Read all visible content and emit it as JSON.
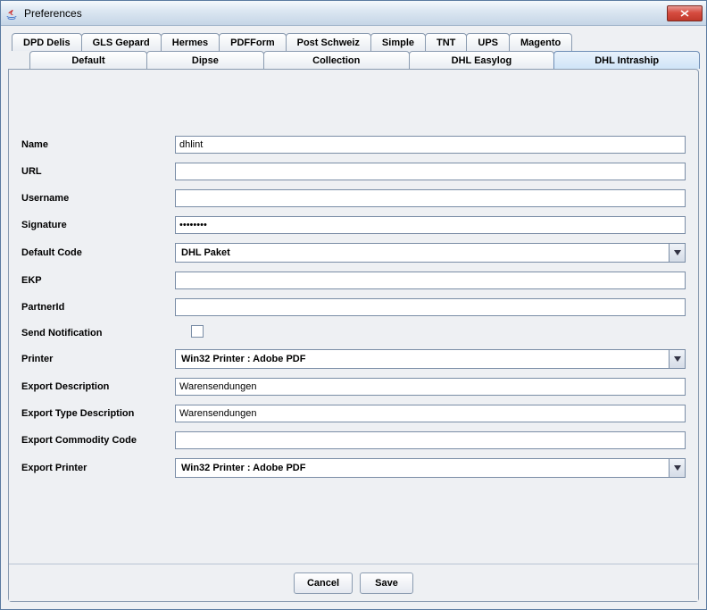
{
  "window": {
    "title": "Preferences"
  },
  "tabs_row1": [
    "DPD Delis",
    "GLS Gepard",
    "Hermes",
    "PDFForm",
    "Post Schweiz",
    "Simple",
    "TNT",
    "UPS",
    "Magento"
  ],
  "tabs_row2": [
    "Default",
    "Dipse",
    "Collection",
    "DHL Easylog",
    "DHL Intraship"
  ],
  "active_tab": "DHL Intraship",
  "form": {
    "name": {
      "label": "Name",
      "value": "dhlint"
    },
    "url": {
      "label": "URL",
      "value": ""
    },
    "username": {
      "label": "Username",
      "value": ""
    },
    "signature": {
      "label": "Signature",
      "value": "••••••••"
    },
    "default_code": {
      "label": "Default Code",
      "value": "DHL Paket"
    },
    "ekp": {
      "label": "EKP",
      "value": ""
    },
    "partnerid": {
      "label": "PartnerId",
      "value": ""
    },
    "send_notification": {
      "label": "Send Notification",
      "checked": false
    },
    "printer": {
      "label": "Printer",
      "value": "Win32 Printer : Adobe PDF"
    },
    "export_description": {
      "label": "Export Description",
      "value": "Warensendungen"
    },
    "export_type_description": {
      "label": "Export Type Description",
      "value": "Warensendungen"
    },
    "export_commodity_code": {
      "label": "Export Commodity Code",
      "value": ""
    },
    "export_printer": {
      "label": "Export Printer",
      "value": "Win32 Printer : Adobe PDF"
    }
  },
  "buttons": {
    "cancel": "Cancel",
    "save": "Save"
  }
}
